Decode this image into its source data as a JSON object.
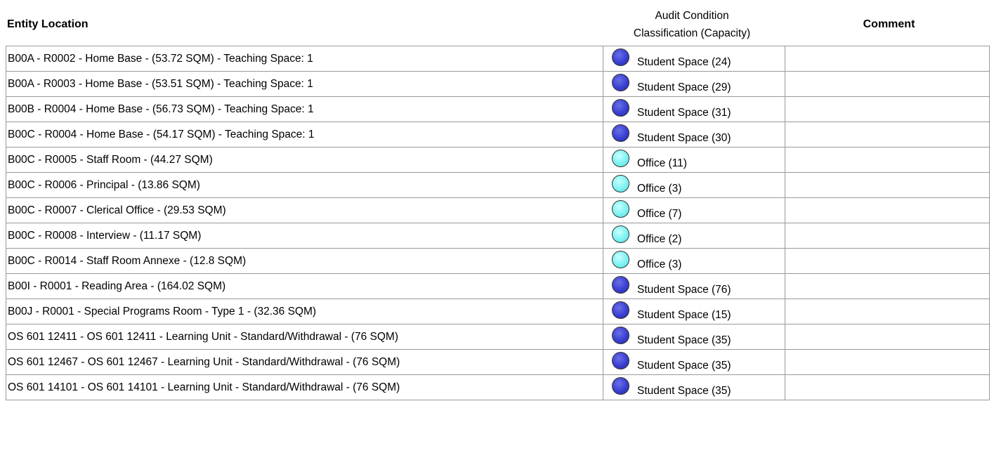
{
  "headers": {
    "location": "Entity Location",
    "classification_line1": "Audit Condition",
    "classification_line2": "Classification (Capacity)",
    "comment": "Comment"
  },
  "legend_colors": {
    "student_space": "#3a3fd0",
    "office": "#7ef2f2"
  },
  "rows": [
    {
      "location": "B00A - R0002 - Home Base - (53.72 SQM) - Teaching Space: 1",
      "classification": "Student Space (24)",
      "type": "student",
      "comment": ""
    },
    {
      "location": "B00A - R0003 - Home Base - (53.51 SQM) - Teaching Space: 1",
      "classification": "Student Space (29)",
      "type": "student",
      "comment": ""
    },
    {
      "location": "B00B - R0004 - Home Base - (56.73 SQM) - Teaching Space: 1",
      "classification": "Student Space (31)",
      "type": "student",
      "comment": ""
    },
    {
      "location": "B00C - R0004 - Home Base - (54.17 SQM) - Teaching Space: 1",
      "classification": "Student Space (30)",
      "type": "student",
      "comment": ""
    },
    {
      "location": "B00C - R0005 - Staff Room - (44.27 SQM)",
      "classification": "Office (11)",
      "type": "office",
      "comment": ""
    },
    {
      "location": "B00C - R0006 - Principal - (13.86 SQM)",
      "classification": "Office (3)",
      "type": "office",
      "comment": ""
    },
    {
      "location": "B00C - R0007 - Clerical Office - (29.53 SQM)",
      "classification": "Office (7)",
      "type": "office",
      "comment": ""
    },
    {
      "location": "B00C - R0008 - Interview - (11.17 SQM)",
      "classification": "Office (2)",
      "type": "office",
      "comment": ""
    },
    {
      "location": "B00C - R0014 - Staff Room Annexe - (12.8 SQM)",
      "classification": "Office (3)",
      "type": "office",
      "comment": ""
    },
    {
      "location": "B00I - R0001 - Reading Area - (164.02 SQM)",
      "classification": "Student Space (76)",
      "type": "student",
      "comment": ""
    },
    {
      "location": "B00J - R0001 - Special Programs Room - Type 1 - (32.36 SQM)",
      "classification": "Student Space (15)",
      "type": "student",
      "comment": ""
    },
    {
      "location": "OS 601 12411 - OS 601 12411 - Learning Unit - Standard/Withdrawal - (76 SQM)",
      "classification": "Student Space (35)",
      "type": "student",
      "comment": ""
    },
    {
      "location": "OS 601 12467 - OS 601 12467 - Learning Unit - Standard/Withdrawal - (76 SQM)",
      "classification": "Student Space (35)",
      "type": "student",
      "comment": ""
    },
    {
      "location": "OS 601 14101 - OS 601 14101 - Learning Unit - Standard/Withdrawal - (76 SQM)",
      "classification": "Student Space (35)",
      "type": "student",
      "comment": ""
    }
  ]
}
